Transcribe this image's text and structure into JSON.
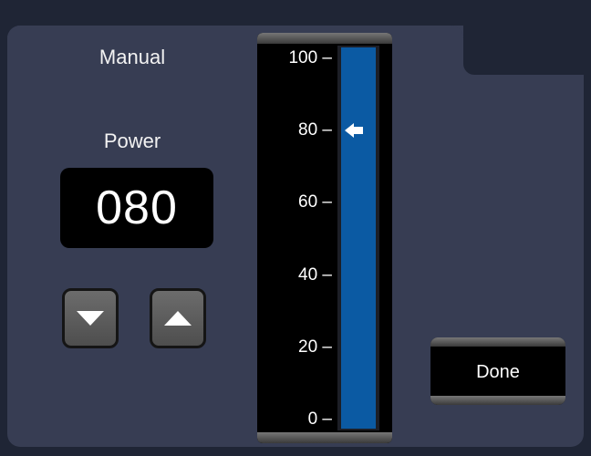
{
  "mode": {
    "label": "Manual"
  },
  "power": {
    "label": "Power",
    "value_display": "080",
    "level": 80,
    "min": 0,
    "max": 100
  },
  "gauge": {
    "ticks": [
      "100 –",
      "80 –",
      "60 –",
      "40 –",
      "20 –",
      "0 –"
    ],
    "tick_values": [
      100,
      80,
      60,
      40,
      20,
      0
    ]
  },
  "buttons": {
    "down_icon": "triangle-down-icon",
    "up_icon": "triangle-up-icon",
    "done_label": "Done"
  },
  "colors": {
    "panel": "#373d53",
    "background": "#1f2535",
    "gauge_fill": "#0b5aa3"
  }
}
